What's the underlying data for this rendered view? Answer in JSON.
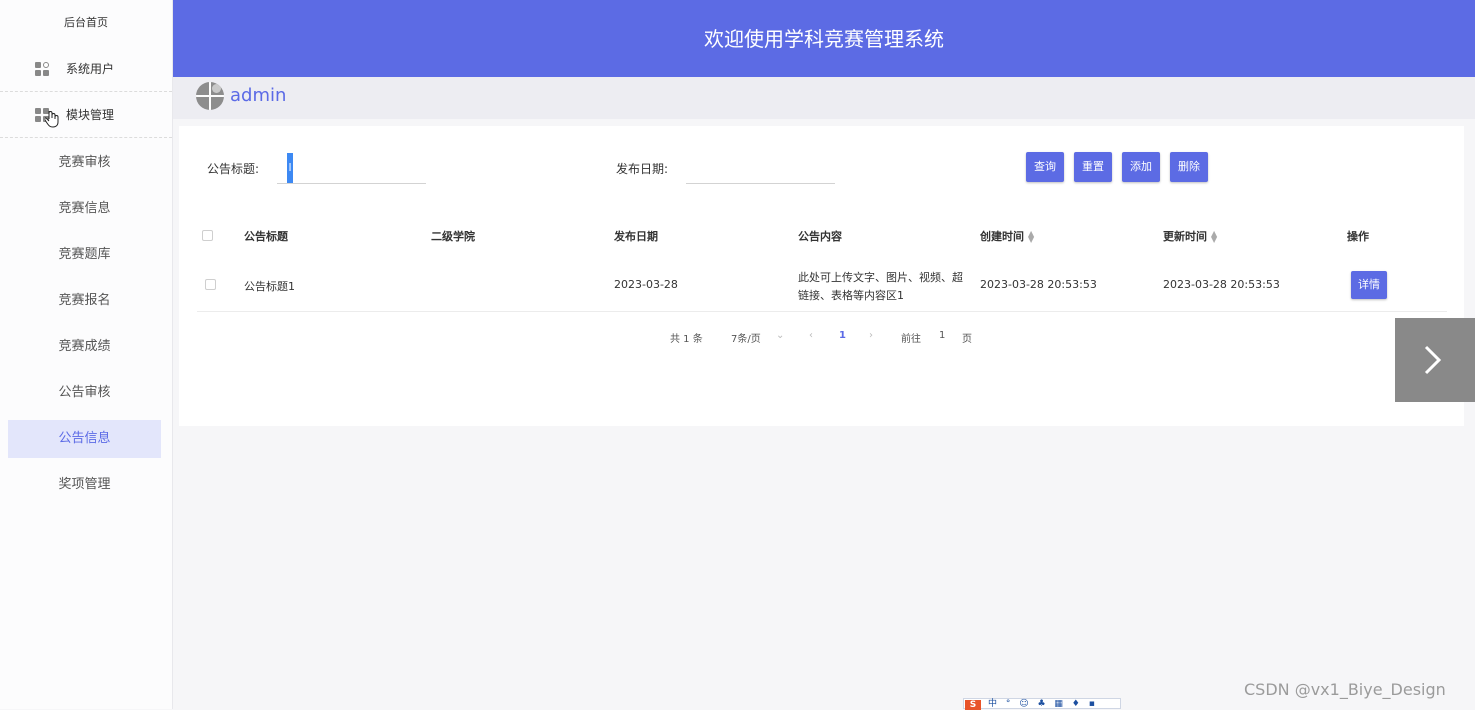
{
  "sidebar": {
    "home": "后台首页",
    "groups": [
      {
        "label": "系统用户",
        "icon": "grid-icon"
      },
      {
        "label": "模块管理",
        "icon": "grid-icon"
      }
    ],
    "items": [
      {
        "label": "竞赛审核"
      },
      {
        "label": "竞赛信息"
      },
      {
        "label": "竞赛题库"
      },
      {
        "label": "竞赛报名"
      },
      {
        "label": "竞赛成绩"
      },
      {
        "label": "公告审核"
      },
      {
        "label": "公告信息",
        "active": true
      },
      {
        "label": "奖项管理"
      }
    ]
  },
  "header": {
    "title": "欢迎使用学科竞赛管理系统"
  },
  "user": {
    "name": "admin"
  },
  "search": {
    "title_label": "公告标题:",
    "title_value": "",
    "cursor_char": "l",
    "date_label": "发布日期:",
    "date_value": "",
    "buttons": {
      "query": "查询",
      "reset": "重置",
      "add": "添加",
      "delete": "删除"
    }
  },
  "table": {
    "columns": [
      "公告标题",
      "二级学院",
      "发布日期",
      "公告内容",
      "创建时间",
      "更新时间",
      "操作"
    ],
    "rows": [
      {
        "title": "公告标题1",
        "college": "",
        "publish_date": "2023-03-28",
        "content_line1": "此处可上传文字、图片、视频、超",
        "content_line2": "链接、表格等内容区1",
        "created": "2023-03-28 20:53:53",
        "updated": "2023-03-28 20:53:53",
        "action": "详情"
      }
    ]
  },
  "pagination": {
    "total": "共 1 条",
    "page_size": "7条/页",
    "current": "1",
    "goto_label": "前往",
    "goto_value": "1",
    "page_suffix": "页"
  },
  "overlay": {
    "next_icon": "chevron-right-icon",
    "watermark": "CSDN @vx1_Biye_Design",
    "ime_text": "中 ° ☺ ♣ ▦ ♦ ▪"
  },
  "colors": {
    "primary": "#5c6be4",
    "active_bg": "#e3e6fb",
    "header_bg": "#5c6be4"
  }
}
